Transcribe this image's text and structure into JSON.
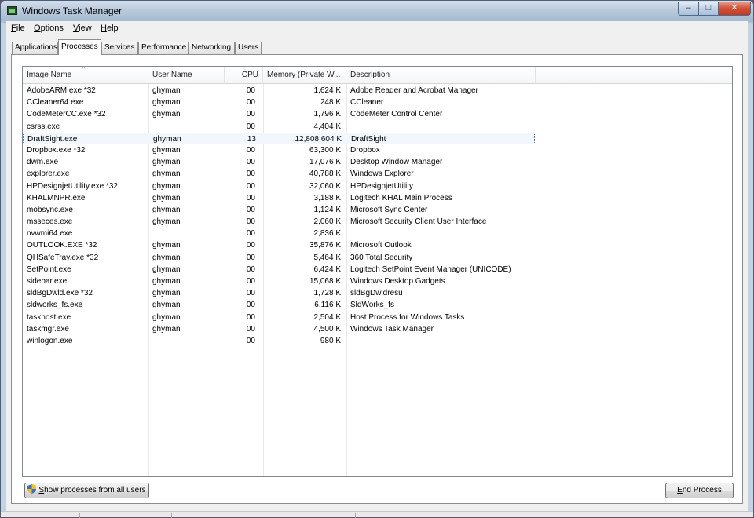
{
  "window": {
    "title": "Windows Task Manager",
    "controls": {
      "minimize": "–",
      "maximize": "□",
      "close": "✕"
    }
  },
  "menu": [
    {
      "label": "File",
      "mnemonic": "F",
      "rest": "ile"
    },
    {
      "label": "Options",
      "mnemonic": "O",
      "rest": "ptions"
    },
    {
      "label": "View",
      "mnemonic": "V",
      "rest": "iew"
    },
    {
      "label": "Help",
      "mnemonic": "H",
      "rest": "elp"
    }
  ],
  "tabs": [
    {
      "label": "Applications",
      "active": false
    },
    {
      "label": "Processes",
      "active": true
    },
    {
      "label": "Services",
      "active": false
    },
    {
      "label": "Performance",
      "active": false
    },
    {
      "label": "Networking",
      "active": false
    },
    {
      "label": "Users",
      "active": false
    }
  ],
  "columns": {
    "name": "Image Name",
    "user": "User Name",
    "cpu": "CPU",
    "memory": "Memory (Private W...",
    "description": "Description",
    "sort_arrow": "^"
  },
  "processes": [
    {
      "name": "AdobeARM.exe *32",
      "user": "ghyman",
      "cpu": "00",
      "memory": "1,624 K",
      "description": "Adobe Reader and Acrobat Manager"
    },
    {
      "name": "CCleaner64.exe",
      "user": "ghyman",
      "cpu": "00",
      "memory": "248 K",
      "description": "CCleaner"
    },
    {
      "name": "CodeMeterCC.exe *32",
      "user": "ghyman",
      "cpu": "00",
      "memory": "1,796 K",
      "description": "CodeMeter Control Center"
    },
    {
      "name": "csrss.exe",
      "user": "",
      "cpu": "00",
      "memory": "4,404 K",
      "description": ""
    },
    {
      "name": "DraftSight.exe",
      "user": "ghyman",
      "cpu": "13",
      "memory": "12,808,604 K",
      "description": "DraftSight",
      "selected": true
    },
    {
      "name": "Dropbox.exe *32",
      "user": "ghyman",
      "cpu": "00",
      "memory": "63,300 K",
      "description": "Dropbox"
    },
    {
      "name": "dwm.exe",
      "user": "ghyman",
      "cpu": "00",
      "memory": "17,076 K",
      "description": "Desktop Window Manager"
    },
    {
      "name": "explorer.exe",
      "user": "ghyman",
      "cpu": "00",
      "memory": "40,788 K",
      "description": "Windows Explorer"
    },
    {
      "name": "HPDesignjetUtility.exe *32",
      "user": "ghyman",
      "cpu": "00",
      "memory": "32,060 K",
      "description": "HPDesignjetUtility"
    },
    {
      "name": "KHALMNPR.exe",
      "user": "ghyman",
      "cpu": "00",
      "memory": "3,188 K",
      "description": "Logitech KHAL Main Process"
    },
    {
      "name": "mobsync.exe",
      "user": "ghyman",
      "cpu": "00",
      "memory": "1,124 K",
      "description": "Microsoft Sync Center"
    },
    {
      "name": "msseces.exe",
      "user": "ghyman",
      "cpu": "00",
      "memory": "2,060 K",
      "description": "Microsoft Security Client User Interface"
    },
    {
      "name": "nvwmi64.exe",
      "user": "",
      "cpu": "00",
      "memory": "2,836 K",
      "description": ""
    },
    {
      "name": "OUTLOOK.EXE *32",
      "user": "ghyman",
      "cpu": "00",
      "memory": "35,876 K",
      "description": "Microsoft Outlook"
    },
    {
      "name": "QHSafeTray.exe *32",
      "user": "ghyman",
      "cpu": "00",
      "memory": "5,464 K",
      "description": "360 Total Security"
    },
    {
      "name": "SetPoint.exe",
      "user": "ghyman",
      "cpu": "00",
      "memory": "6,424 K",
      "description": "Logitech SetPoint Event Manager (UNICODE)"
    },
    {
      "name": "sidebar.exe",
      "user": "ghyman",
      "cpu": "00",
      "memory": "15,068 K",
      "description": "Windows Desktop Gadgets"
    },
    {
      "name": "sldBgDwld.exe *32",
      "user": "ghyman",
      "cpu": "00",
      "memory": "1,728 K",
      "description": "sldBgDwldresu"
    },
    {
      "name": "sldworks_fs.exe",
      "user": "ghyman",
      "cpu": "00",
      "memory": "6,116 K",
      "description": "SldWorks_fs"
    },
    {
      "name": "taskhost.exe",
      "user": "ghyman",
      "cpu": "00",
      "memory": "2,504 K",
      "description": "Host Process for Windows Tasks"
    },
    {
      "name": "taskmgr.exe",
      "user": "ghyman",
      "cpu": "00",
      "memory": "4,500 K",
      "description": "Windows Task Manager"
    },
    {
      "name": "winlogon.exe",
      "user": "",
      "cpu": "00",
      "memory": "980 K",
      "description": ""
    }
  ],
  "buttons": {
    "show_all": {
      "mnemonic": "S",
      "rest": "how processes from all users"
    },
    "end_process": {
      "mnemonic": "E",
      "rest": "nd Process"
    }
  },
  "icons": {
    "app": "task-manager-icon",
    "uac": "uac-shield-icon"
  }
}
